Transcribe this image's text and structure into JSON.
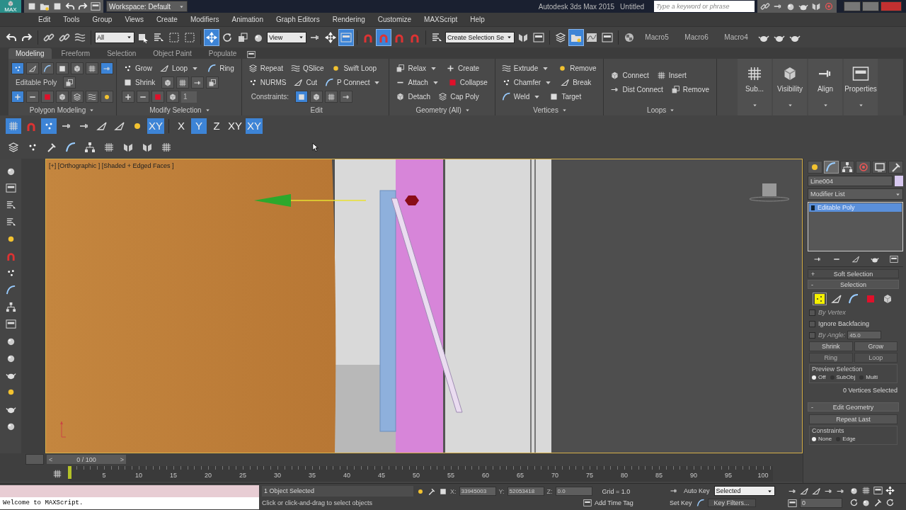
{
  "title_bar": {
    "app_button": "MAX",
    "workspace": "Workspace: Default",
    "title": "Autodesk 3ds Max 2015",
    "document": "Untitled",
    "search": {
      "placeholder": "Type a keyword or phrase"
    }
  },
  "menu": [
    "Edit",
    "Tools",
    "Group",
    "Views",
    "Create",
    "Modifiers",
    "Animation",
    "Graph Editors",
    "Rendering",
    "Customize",
    "MAXScript",
    "Help"
  ],
  "main_toolbar": [
    {
      "kind": "icon",
      "selected": false
    },
    {
      "kind": "icon",
      "selected": false
    },
    {
      "kind": "sep"
    },
    {
      "kind": "icon",
      "selected": false
    },
    {
      "kind": "icon",
      "selected": false
    },
    {
      "kind": "icon",
      "selected": false
    },
    {
      "kind": "sep"
    },
    {
      "kind": "dropdown",
      "value": "All"
    },
    {
      "kind": "icon",
      "selected": false
    },
    {
      "kind": "icon",
      "selected": false
    },
    {
      "kind": "icon",
      "selected": false
    },
    {
      "kind": "icon",
      "selected": false
    },
    {
      "kind": "sep"
    },
    {
      "kind": "icon",
      "selected": true
    },
    {
      "kind": "icon",
      "selected": false
    },
    {
      "kind": "icon",
      "selected": false
    },
    {
      "kind": "icon",
      "selected": false
    },
    {
      "kind": "dropdown",
      "value": "View"
    },
    {
      "kind": "icon",
      "selected": false
    },
    {
      "kind": "icon",
      "selected": false
    },
    {
      "kind": "icon",
      "selected": true
    },
    {
      "kind": "sep"
    },
    {
      "kind": "icon",
      "selected": false
    },
    {
      "kind": "icon",
      "selected": true
    },
    {
      "kind": "icon",
      "selected": false
    },
    {
      "kind": "icon",
      "selected": false
    },
    {
      "kind": "sep"
    },
    {
      "kind": "icon",
      "selected": false
    },
    {
      "kind": "dropdown",
      "value": "Create Selection Se"
    },
    {
      "kind": "icon",
      "selected": false
    },
    {
      "kind": "icon",
      "selected": false
    },
    {
      "kind": "sep"
    },
    {
      "kind": "icon",
      "selected": false
    },
    {
      "kind": "icon",
      "selected": true
    },
    {
      "kind": "icon",
      "selected": false
    },
    {
      "kind": "icon",
      "selected": false
    },
    {
      "kind": "sep"
    },
    {
      "kind": "icon",
      "selected": false
    },
    {
      "kind": "macro",
      "label": "Macro5"
    },
    {
      "kind": "macro",
      "label": "Macro6"
    },
    {
      "kind": "macro",
      "label": "Macro4"
    },
    {
      "kind": "icon",
      "selected": false
    },
    {
      "kind": "icon",
      "selected": false
    },
    {
      "kind": "icon",
      "selected": false
    }
  ],
  "ribbon": {
    "tabs": [
      {
        "label": "Modeling",
        "selected": true
      },
      {
        "label": "Freeform",
        "selected": false
      },
      {
        "label": "Selection",
        "selected": false
      },
      {
        "label": "Object Paint",
        "selected": false
      },
      {
        "label": "Populate",
        "selected": false
      }
    ],
    "panels": [
      {
        "title": "Polygon Modeling",
        "dropdown": true,
        "rows": [
          [
            {
              "kind": "icon",
              "selected": true
            },
            {
              "kind": "icon",
              "selected": false
            },
            {
              "kind": "icon",
              "selected": false
            },
            {
              "kind": "icon",
              "selected": false
            },
            {
              "kind": "icon",
              "selected": false
            },
            {
              "kind": "icon",
              "selected": false
            },
            {
              "kind": "icon",
              "selected": true
            }
          ],
          [
            {
              "kind": "label",
              "text": "Editable Poly"
            },
            {
              "kind": "icon",
              "selected": false
            }
          ],
          [
            {
              "kind": "icon",
              "selected": true
            },
            {
              "kind": "icon",
              "selected": false
            },
            {
              "kind": "icon",
              "selected": false
            },
            {
              "kind": "icon",
              "selected": false
            },
            {
              "kind": "icon",
              "selected": false
            },
            {
              "kind": "icon",
              "selected": false
            },
            {
              "kind": "icon",
              "selected": false
            }
          ]
        ]
      },
      {
        "title": "Modify Selection",
        "dropdown": true,
        "rows": [
          [
            {
              "kind": "button",
              "label": "Grow",
              "dropdown": false
            },
            {
              "kind": "button",
              "label": "Loop",
              "dropdown": true
            },
            {
              "kind": "button",
              "label": "Ring",
              "dropdown": false
            }
          ],
          [
            {
              "kind": "button",
              "label": "Shrink",
              "dropdown": false
            },
            {
              "kind": "icon",
              "selected": false
            },
            {
              "kind": "icon",
              "selected": false
            },
            {
              "kind": "icon",
              "selected": false
            },
            {
              "kind": "icon",
              "selected": false
            }
          ],
          [
            {
              "kind": "icon",
              "selected": false
            },
            {
              "kind": "icon",
              "selected": false
            },
            {
              "kind": "icon",
              "selected": false
            },
            {
              "kind": "icon",
              "selected": false
            },
            {
              "kind": "spinner",
              "value": "1"
            }
          ]
        ]
      },
      {
        "title": "Edit",
        "dropdown": false,
        "rows": [
          [
            {
              "kind": "button",
              "label": "Repeat",
              "dropdown": false
            },
            {
              "kind": "button",
              "label": "QSlice",
              "dropdown": false
            },
            {
              "kind": "button",
              "label": "Swift Loop",
              "dropdown": false
            }
          ],
          [
            {
              "kind": "button",
              "label": "NURMS",
              "dropdown": false
            },
            {
              "kind": "button",
              "label": "Cut",
              "dropdown": false
            },
            {
              "kind": "button",
              "label": "P Connect",
              "dropdown": true
            }
          ],
          [
            {
              "kind": "label",
              "text": "Constraints:"
            },
            {
              "kind": "icon",
              "selected": true
            },
            {
              "kind": "icon",
              "selected": false
            },
            {
              "kind": "icon",
              "selected": false
            },
            {
              "kind": "icon",
              "selected": false
            }
          ]
        ]
      },
      {
        "title": "Geometry (All)",
        "dropdown": true,
        "rows": [
          [
            {
              "kind": "button",
              "label": "Relax",
              "dropdown": true
            },
            {
              "kind": "button",
              "label": "Create",
              "dropdown": false
            }
          ],
          [
            {
              "kind": "button",
              "label": "Attach",
              "dropdown": true
            },
            {
              "kind": "button",
              "label": "Collapse",
              "dropdown": false
            }
          ],
          [
            {
              "kind": "button",
              "label": "Detach",
              "dropdown": false
            },
            {
              "kind": "button",
              "label": "Cap Poly",
              "dropdown": false
            }
          ]
        ]
      },
      {
        "title": "Vertices",
        "dropdown": true,
        "rows": [
          [
            {
              "kind": "button",
              "label": "Extrude",
              "dropdown": true
            },
            {
              "kind": "button",
              "label": "Remove",
              "dropdown": false
            }
          ],
          [
            {
              "kind": "button",
              "label": "Chamfer",
              "dropdown": true
            },
            {
              "kind": "button",
              "label": "Break",
              "dropdown": false
            }
          ],
          [
            {
              "kind": "button",
              "label": "Weld",
              "dropdown": true
            },
            {
              "kind": "button",
              "label": "Target",
              "dropdown": false
            }
          ]
        ]
      },
      {
        "title": "Loops",
        "dropdown": true,
        "rows": [
          [
            {
              "kind": "button",
              "label": "Connect",
              "dropdown": false
            },
            {
              "kind": "button",
              "label": "Insert",
              "dropdown": false
            }
          ],
          [
            {
              "kind": "button",
              "label": "Dist Connect",
              "dropdown": false
            },
            {
              "kind": "button",
              "label": "Remove",
              "dropdown": false
            }
          ]
        ]
      }
    ],
    "large_buttons": [
      "Sub...",
      "Visibility",
      "Align",
      "Properties"
    ]
  },
  "snap_toolbar": {
    "tools": [
      {
        "selected": true
      },
      {
        "selected": false
      },
      {
        "selected": true
      },
      {
        "selected": false
      },
      {
        "selected": false
      },
      {
        "selected": false
      },
      {
        "selected": false
      },
      {
        "selected": false
      }
    ],
    "axes": [
      {
        "label": "XY",
        "selected": true
      },
      {
        "label": "X",
        "selected": false
      },
      {
        "label": "Y",
        "selected": true
      },
      {
        "label": "Z",
        "selected": false
      },
      {
        "label": "XY",
        "selected": false
      },
      {
        "label": "XY",
        "selected": true
      }
    ]
  },
  "viewport": {
    "label": "[+] [Orthographic ] [Shaded + Edged Faces ]",
    "active": true
  },
  "command_panel": {
    "tabs": [
      {
        "selected": false
      },
      {
        "selected": true
      },
      {
        "selected": false
      },
      {
        "selected": false
      },
      {
        "selected": false
      },
      {
        "selected": false
      }
    ],
    "object_name": "Line004",
    "modifier_list": "Modifier List",
    "stack": [
      {
        "label": "Editable Poly",
        "selected": true
      }
    ],
    "rollouts": [
      {
        "kind": "collapsed",
        "toggle": "+",
        "title": "Soft Selection",
        "expanded": false
      },
      {
        "kind": "selection",
        "toggle": "-",
        "title": "Selection",
        "expanded": true,
        "subobjects": [
          {
            "selected": true
          },
          {
            "selected": false
          },
          {
            "selected": false
          },
          {
            "selected": false
          },
          {
            "selected": false
          }
        ],
        "checkboxes": [
          {
            "label": "By Vertex",
            "checked": false,
            "disabled": true
          },
          {
            "label": "Ignore Backfacing",
            "checked": false,
            "disabled": false
          },
          {
            "label": "By Angle:",
            "checked": false,
            "disabled": true,
            "value": "45.0"
          }
        ],
        "buttons": [
          "Shrink",
          "Grow"
        ],
        "spinners": [
          {
            "label": "Ring",
            "disabled": true
          },
          {
            "label": "Loop",
            "disabled": true
          }
        ],
        "preview": {
          "title": "Preview Selection",
          "options": [
            {
              "label": "Off",
              "selected": true
            },
            {
              "label": "SubObj",
              "selected": false
            },
            {
              "label": "Multi",
              "selected": false
            }
          ]
        },
        "status": "0 Vertices Selected"
      },
      {
        "kind": "edit_geometry",
        "toggle": "-",
        "title": "Edit Geometry",
        "expanded": true,
        "button": "Repeat Last",
        "constraints": {
          "title": "Constraints",
          "options": [
            {
              "label": "None",
              "selected": true
            },
            {
              "label": "Edge",
              "selected": false
            }
          ]
        }
      }
    ]
  },
  "timeline": {
    "curve_editor_open": false,
    "prev": "<",
    "range": "0 / 100",
    "next": ">",
    "ticks": [
      "5",
      "10",
      "15",
      "20",
      "25",
      "30",
      "35",
      "40",
      "45",
      "50",
      "55",
      "60",
      "65",
      "70",
      "75",
      "80",
      "85",
      "90",
      "95",
      "100"
    ]
  },
  "status_bar": {
    "listener": "Welcome to MAXScript.",
    "selection": "1 Object Selected",
    "prompt": "Click or click-and-drag to select objects",
    "coords": [
      {
        "axis": "X:",
        "value": "33945003"
      },
      {
        "axis": "Y:",
        "value": "52053418"
      },
      {
        "axis": "Z:",
        "value": "0.0"
      }
    ],
    "grid": "Grid = 1.0",
    "time_tag": "Add Time Tag",
    "auto_key": "Auto Key",
    "key_mode": "Selected",
    "set_key": "Set Key",
    "key_filters": "Key Filters...",
    "frame": "0"
  }
}
